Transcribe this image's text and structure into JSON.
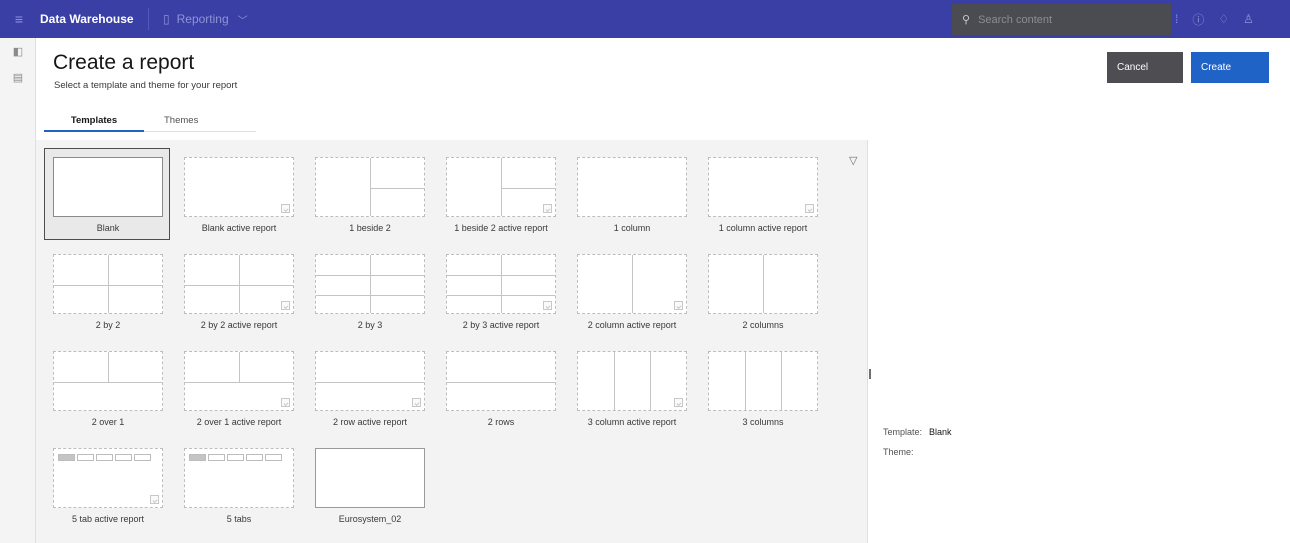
{
  "topbar": {
    "app_name": "Data Warehouse",
    "workspace": "Reporting",
    "search_placeholder": "Search content"
  },
  "header": {
    "title": "Create a report",
    "subtitle": "Select a template and theme for your report",
    "cancel_label": "Cancel",
    "create_label": "Create"
  },
  "tabs": {
    "templates": "Templates",
    "themes": "Themes"
  },
  "templates": [
    "Blank",
    "Blank active report",
    "1 beside 2",
    "1 beside 2 active report",
    "1 column",
    "1 column active report",
    "2 by 2",
    "2 by 2 active report",
    "2 by 3",
    "2 by 3 active report",
    "2 column active report",
    "2 columns",
    "2 over 1",
    "2 over 1 active report",
    "2 row active report",
    "2 rows",
    "3 column active report",
    "3 columns",
    "5 tab active report",
    "5 tabs",
    "Eurosystem_02"
  ],
  "selected_template": "Blank",
  "details": {
    "template_label": "Template:",
    "template_value": "Blank",
    "theme_label": "Theme:"
  },
  "colors": {
    "topbar": "#3a3fa5",
    "primary_button": "#1f63c6",
    "secondary_button": "#4d4d52"
  },
  "icons": [
    "menu-icon",
    "document-icon",
    "chevron-down-icon",
    "search-icon",
    "info-icon",
    "help-icon",
    "notification-icon",
    "user-icon",
    "panel-icon",
    "file-icon",
    "filter-icon"
  ]
}
